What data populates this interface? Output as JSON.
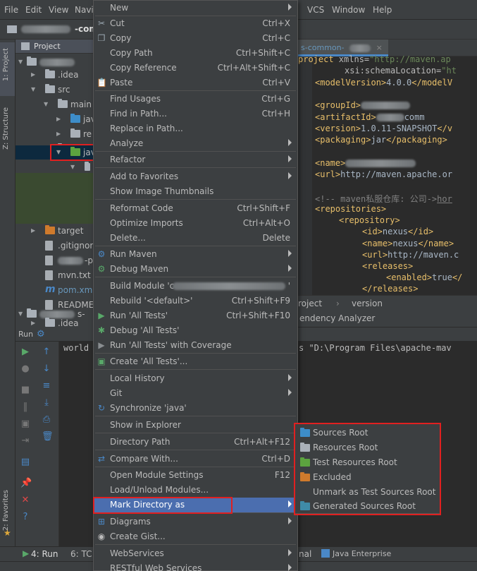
{
  "menubar": {
    "file": "File",
    "edit": "Edit",
    "view": "View",
    "navigate": "Navi",
    "vcs": "VCS",
    "window": "Window",
    "help": "Help"
  },
  "navbar": {
    "project_suffix": "-commo"
  },
  "tool_strip": {
    "project": "1: Project",
    "structure": "Z: Structure",
    "favorites": "2: Favorites"
  },
  "project": {
    "header": "Project",
    "tree": [
      {
        "label": ".idea"
      },
      {
        "label": "src"
      },
      {
        "label": "main"
      },
      {
        "label": "jav"
      },
      {
        "label": "re"
      },
      {
        "label": "test"
      },
      {
        "label": "jav"
      },
      {
        "label": "target"
      },
      {
        "label": ".gitignore"
      },
      {
        "label": "-p"
      },
      {
        "label": "mvn.txt"
      },
      {
        "label": "pom.xml"
      },
      {
        "label": "README"
      },
      {
        "label": "s-"
      },
      {
        "label": ".idea"
      }
    ]
  },
  "editor": {
    "tab_label": "s-common-",
    "lines": [
      {
        "tag_open": "project",
        "attr1": " xmlns=",
        "val1": "\"http://maven.ap"
      },
      {
        "attr1": "xsi:schemaLocation=",
        "val1": "\"ht"
      },
      {
        "tag_open": "<modelVersion>",
        "text": "4.0.0",
        "tag_close": "</modelV"
      },
      {
        "tag_open": "<groupId>"
      },
      {
        "tag_open": "<artifactId>",
        "text": "comm"
      },
      {
        "tag_open": "<version>",
        "text": "1.0.11-SNAPSHOT",
        "tag_close": "</v"
      },
      {
        "tag_open": "<packaging>",
        "text": "jar",
        "tag_close": "</packaging>"
      },
      {
        "tag_open": "<name>"
      },
      {
        "tag_open": "<url>",
        "text": "http://maven.apache.or"
      },
      {
        "comment": "<!-- maven私服仓库: 公司->",
        "comment_link": "hor"
      },
      {
        "tag_open": "<repositories>"
      },
      {
        "tag_open": "<repository>"
      },
      {
        "tag_open": "<id>",
        "text": "nexus",
        "tag_close": "</id>"
      },
      {
        "tag_open": "<name>",
        "text": "nexus",
        "tag_close": "</name>"
      },
      {
        "tag_open": "<url>",
        "text": "http://maven.c"
      },
      {
        "tag_open": "<releases>"
      },
      {
        "tag_open": "<enabled>",
        "text": "true",
        "tag_close": "</"
      },
      {
        "tag_open": "</releases>"
      }
    ],
    "breadcrumb": [
      "roject",
      "version"
    ],
    "dep_tab": "endency Analyzer"
  },
  "run": {
    "header": "Run",
    "output_prefix": "world",
    "output_suffix": "s \"D:\\Program Files\\apache-mav"
  },
  "bottom": {
    "run_tab": "4: Run",
    "todo_tab": "6: TC",
    "terminal": "nal",
    "java_enterprise": "Java Enterprise"
  },
  "context_menu": [
    {
      "label": "New",
      "shortcut": "",
      "submenu": true,
      "icon": ""
    },
    {
      "label": "Cut",
      "shortcut": "Ctrl+X",
      "icon": "scissors-icon"
    },
    {
      "label": "Copy",
      "shortcut": "Ctrl+C",
      "icon": "copy-icon"
    },
    {
      "label": "Copy Path",
      "shortcut": "Ctrl+Shift+C"
    },
    {
      "label": "Copy Reference",
      "shortcut": "Ctrl+Alt+Shift+C"
    },
    {
      "label": "Paste",
      "shortcut": "Ctrl+V",
      "icon": "paste-icon"
    },
    {
      "label": "Find Usages",
      "shortcut": "Ctrl+G"
    },
    {
      "label": "Find in Path...",
      "shortcut": "Ctrl+H"
    },
    {
      "label": "Replace in Path..."
    },
    {
      "label": "Analyze",
      "submenu": true
    },
    {
      "label": "Refactor",
      "submenu": true
    },
    {
      "label": "Add to Favorites",
      "submenu": true
    },
    {
      "label": "Show Image Thumbnails"
    },
    {
      "label": "Reformat Code",
      "shortcut": "Ctrl+Shift+F"
    },
    {
      "label": "Optimize Imports",
      "shortcut": "Ctrl+Alt+O"
    },
    {
      "label": "Delete...",
      "shortcut": "Delete"
    },
    {
      "label": "Run Maven",
      "submenu": true,
      "icon": "maven-run-icon"
    },
    {
      "label": "Debug Maven",
      "submenu": true,
      "icon": "maven-debug-icon"
    },
    {
      "label": "Build Module 'c",
      "suffix": "'"
    },
    {
      "label": "Rebuild '<default>'",
      "shortcut": "Ctrl+Shift+F9"
    },
    {
      "label": "Run 'All Tests'",
      "shortcut": "Ctrl+Shift+F10",
      "icon": "run-icon"
    },
    {
      "label": "Debug 'All Tests'",
      "icon": "debug-icon"
    },
    {
      "label": "Run 'All Tests' with Coverage",
      "icon": "coverage-icon"
    },
    {
      "label": "Create 'All Tests'...",
      "icon": "create-test-icon"
    },
    {
      "label": "Local History",
      "submenu": true
    },
    {
      "label": "Git",
      "submenu": true
    },
    {
      "label": "Synchronize 'java'",
      "icon": "sync-icon"
    },
    {
      "label": "Show in Explorer"
    },
    {
      "label": "Directory Path",
      "shortcut": "Ctrl+Alt+F12"
    },
    {
      "label": "Compare With...",
      "shortcut": "Ctrl+D",
      "icon": "compare-icon"
    },
    {
      "label": "Open Module Settings",
      "shortcut": "F12"
    },
    {
      "label": "Load/Unload Modules..."
    },
    {
      "label": "Mark Directory as",
      "submenu": true
    },
    {
      "label": "Diagrams",
      "submenu": true,
      "icon": "diagram-icon"
    },
    {
      "label": "Create Gist...",
      "icon": "gist-icon"
    },
    {
      "label": "WebServices",
      "submenu": true
    },
    {
      "label": "RESTful Web Services",
      "submenu": true
    }
  ],
  "mark_submenu": [
    {
      "label": "Sources Root",
      "color": "#3d8dc9"
    },
    {
      "label": "Resources Root",
      "color": "#a9b0b8"
    },
    {
      "label": "Test Resources Root",
      "color": "#5ca33f"
    },
    {
      "label": "Excluded",
      "color": "#cf7a2c"
    },
    {
      "label": "Unmark as Test Sources Root",
      "color": ""
    },
    {
      "label": "Generated Sources Root",
      "color": "#3f8ba8"
    }
  ],
  "colors": {
    "selection": "#4b6eaf",
    "highlight_box": "#e02020",
    "background": "#3c3f41"
  }
}
